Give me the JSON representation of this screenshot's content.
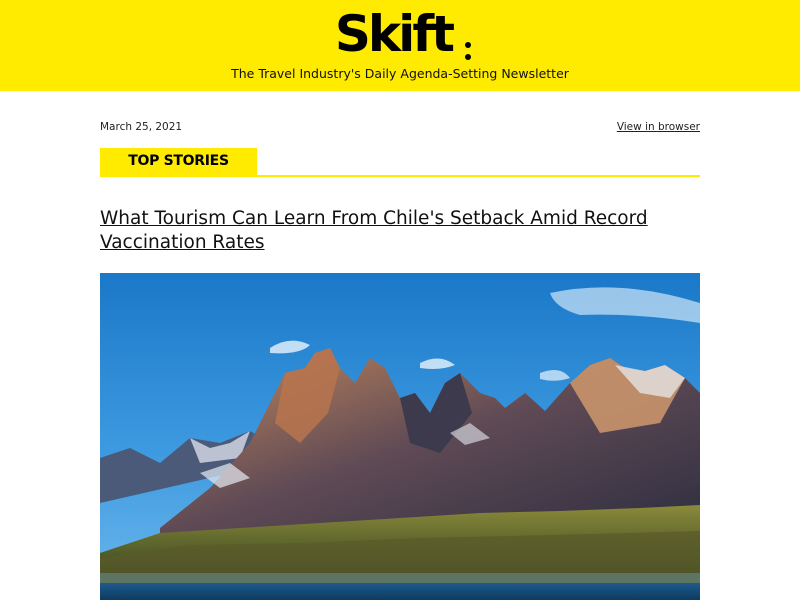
{
  "header": {
    "logo_text": "Skift",
    "tagline": "The Travel Industry's Daily Agenda-Setting Newsletter"
  },
  "meta": {
    "date": "March 25, 2021",
    "view_in_browser": "View in browser"
  },
  "section": {
    "label": "TOP STORIES"
  },
  "article": {
    "headline": "What Tourism Can Learn From Chile's Setback Amid Record Vaccination Rates",
    "image_icon": "mountain-landscape-image"
  },
  "colors": {
    "brand_yellow": "#ffeb00",
    "text": "#111111"
  }
}
